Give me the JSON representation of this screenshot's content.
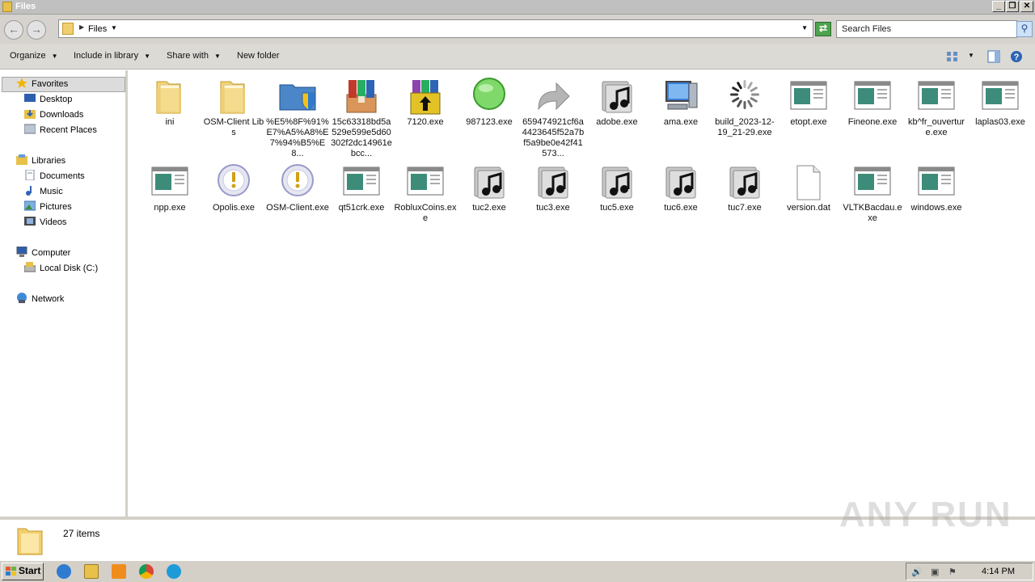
{
  "window": {
    "title": "Files",
    "minimize": "_",
    "maximize": "❐",
    "close": "✕"
  },
  "address": {
    "crumb": "Files",
    "search_placeholder": "Search Files"
  },
  "toolbar": {
    "organize": "Organize",
    "include_in_library": "Include in library",
    "share_with": "Share with",
    "new_folder": "New folder"
  },
  "nav": {
    "favorites": "Favorites",
    "desktop": "Desktop",
    "downloads": "Downloads",
    "recent_places": "Recent Places",
    "libraries": "Libraries",
    "documents": "Documents",
    "music": "Music",
    "pictures": "Pictures",
    "videos": "Videos",
    "computer": "Computer",
    "local_disk": "Local Disk (C:)",
    "network": "Network"
  },
  "files": [
    {
      "name": "ini",
      "icon": "folder-icon"
    },
    {
      "name": "OSM-Client Libs",
      "icon": "folder-icon"
    },
    {
      "name": "%E5%8F%91%E7%A5%A8%E7%94%B5%E8...",
      "icon": "shield-folder-icon"
    },
    {
      "name": "15c63318bd5a529e599e5d60302f2dc14961ebcc...",
      "icon": "winrar-icon"
    },
    {
      "name": "7120.exe",
      "icon": "installer-box-icon"
    },
    {
      "name": "987123.exe",
      "icon": "green-circle-icon"
    },
    {
      "name": "659474921cf6a4423645f52a7bf5a9be0e42f41573...",
      "icon": "shortcut-arrow-icon"
    },
    {
      "name": "adobe.exe",
      "icon": "media-file-icon"
    },
    {
      "name": "ama.exe",
      "icon": "computer-icon"
    },
    {
      "name": "build_2023-12-19_21-29.exe",
      "icon": "loading-spinner-icon"
    },
    {
      "name": "etopt.exe",
      "icon": "window-app-icon"
    },
    {
      "name": "Fineone.exe",
      "icon": "window-app-icon"
    },
    {
      "name": "kb^fr_ouverture.exe",
      "icon": "window-app-icon"
    },
    {
      "name": "laplas03.exe",
      "icon": "window-app-icon"
    },
    {
      "name": "npp.exe",
      "icon": "window-app-icon"
    },
    {
      "name": "Opolis.exe",
      "icon": "warning-disc-icon"
    },
    {
      "name": "OSM-Client.exe",
      "icon": "warning-disc-icon"
    },
    {
      "name": "qt51crk.exe",
      "icon": "window-app-icon"
    },
    {
      "name": "RobluxCoins.exe",
      "icon": "window-app-icon"
    },
    {
      "name": "tuc2.exe",
      "icon": "media-file-icon"
    },
    {
      "name": "tuc3.exe",
      "icon": "media-file-icon"
    },
    {
      "name": "tuc5.exe",
      "icon": "media-file-icon"
    },
    {
      "name": "tuc6.exe",
      "icon": "media-file-icon"
    },
    {
      "name": "tuc7.exe",
      "icon": "media-file-icon"
    },
    {
      "name": "version.dat",
      "icon": "blank-document-icon"
    },
    {
      "name": "VLTKBacdau.exe",
      "icon": "window-app-icon"
    },
    {
      "name": "windows.exe",
      "icon": "window-app-icon"
    }
  ],
  "status": {
    "item_count": "27 items"
  },
  "watermark": "ANY RUN",
  "taskbar": {
    "start": "Start",
    "clock": "4:14 PM"
  }
}
